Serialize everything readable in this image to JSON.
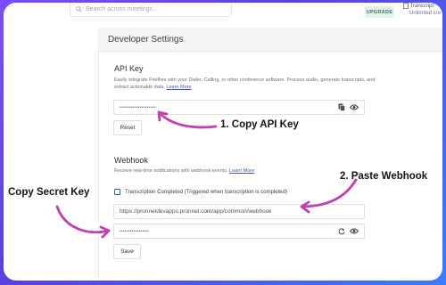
{
  "header": {
    "search_placeholder": "Search across meetings...",
    "upgrade_label": "UPGRADE",
    "transcript_label": "Transcript",
    "transcript_sub": "Unlimited cre"
  },
  "panel": {
    "title": "Developer Settings",
    "api_key": {
      "title": "API Key",
      "desc_line1": "Easily integrate Fireflies with your Dialer, Calling, or other conference software. Process audio, generate transcripts, and",
      "desc_line2": "extract actionable data.",
      "learn_more": "Learn More",
      "value": "••••••••••••••••••••",
      "reset_label": "Reset"
    },
    "webhook": {
      "title": "Webhook",
      "desc": "Receive real-time notifications with webhook events.",
      "learn_more": "Learn More",
      "checkbox_label": "Transcription Completed (Triggered when transcription is completed)",
      "checkbox_checked": false,
      "url_value": "https://pronneldevapps.pronnel.com/app/common/webhook",
      "secret_value": "•••••••••••••••••",
      "save_label": "Save"
    }
  },
  "annotations": {
    "copy_api_key": "1. Copy API Key",
    "paste_webhook": "2. Paste Webhook",
    "copy_secret_key": "Copy Secret Key"
  },
  "colors": {
    "arrow": "#c040b0",
    "border_gradient_start": "#7c4dff",
    "border_gradient_end": "#3a7bff"
  }
}
